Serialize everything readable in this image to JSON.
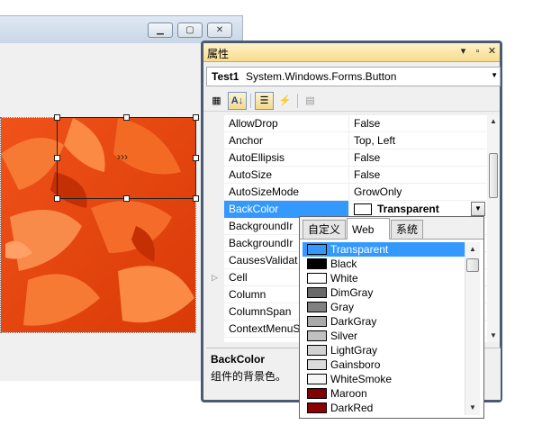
{
  "properties_window": {
    "title": "属性",
    "object_name": "Test1",
    "object_type": "System.Windows.Forms.Button",
    "rows": [
      {
        "name": "AllowDrop",
        "value": "False"
      },
      {
        "name": "Anchor",
        "value": "Top, Left"
      },
      {
        "name": "AutoEllipsis",
        "value": "False"
      },
      {
        "name": "AutoSize",
        "value": "False"
      },
      {
        "name": "AutoSizeMode",
        "value": "GrowOnly"
      },
      {
        "name": "BackColor",
        "value": "Transparent"
      },
      {
        "name": "BackgroundIr",
        "value": ""
      },
      {
        "name": "BackgroundIr",
        "value": ""
      },
      {
        "name": "CausesValidat",
        "value": ""
      },
      {
        "name": "Cell",
        "value": ""
      },
      {
        "name": "Column",
        "value": ""
      },
      {
        "name": "ColumnSpan",
        "value": ""
      },
      {
        "name": "ContextMenuS",
        "value": ""
      }
    ],
    "description_title": "BackColor",
    "description_text": "组件的背景色。"
  },
  "color_popup": {
    "tabs": [
      "自定义",
      "Web",
      "系统"
    ],
    "active_tab": "Web",
    "colors": [
      {
        "name": "Transparent",
        "swatch": "#3399ff"
      },
      {
        "name": "Black",
        "swatch": "#000000"
      },
      {
        "name": "White",
        "swatch": "#ffffff"
      },
      {
        "name": "DimGray",
        "swatch": "#696969"
      },
      {
        "name": "Gray",
        "swatch": "#808080"
      },
      {
        "name": "DarkGray",
        "swatch": "#a9a9a9"
      },
      {
        "name": "Silver",
        "swatch": "#c0c0c0"
      },
      {
        "name": "LightGray",
        "swatch": "#d3d3d3"
      },
      {
        "name": "Gainsboro",
        "swatch": "#dcdcdc"
      },
      {
        "name": "WhiteSmoke",
        "swatch": "#f5f5f5"
      },
      {
        "name": "Maroon",
        "swatch": "#800000"
      },
      {
        "name": "DarkRed",
        "swatch": "#8b0000"
      }
    ],
    "selected": "Transparent"
  },
  "colors": {
    "selection": "#3399ff",
    "title_bar": "#f7dc8c",
    "window_frame": "#4b5b75"
  }
}
